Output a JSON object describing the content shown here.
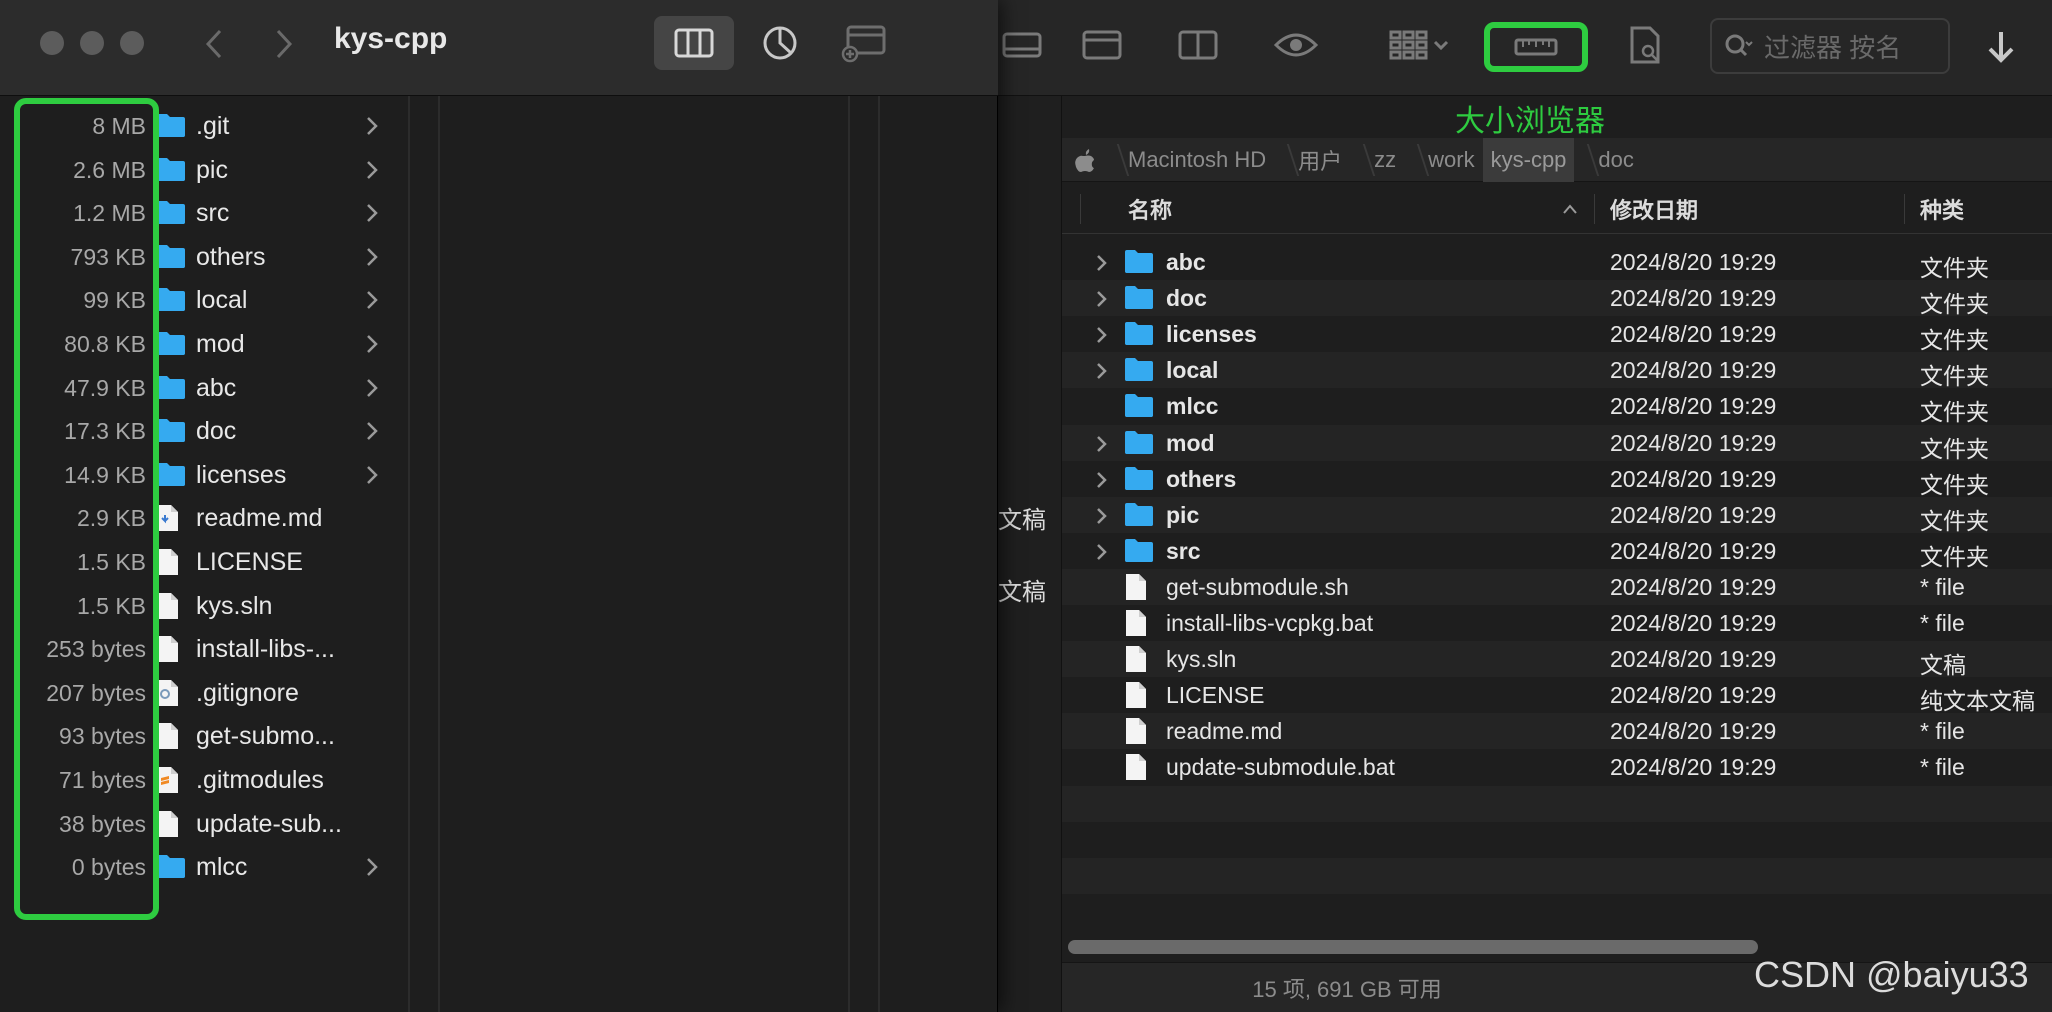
{
  "front_window": {
    "title": "kys-cpp",
    "rows": [
      {
        "size": "8 MB",
        "name": ".git",
        "icon": "folder",
        "has_children": true
      },
      {
        "size": "2.6 MB",
        "name": "pic",
        "icon": "folder",
        "has_children": true
      },
      {
        "size": "1.2 MB",
        "name": "src",
        "icon": "folder",
        "has_children": true
      },
      {
        "size": "793 KB",
        "name": "others",
        "icon": "folder",
        "has_children": true
      },
      {
        "size": "99 KB",
        "name": "local",
        "icon": "folder",
        "has_children": true
      },
      {
        "size": "80.8 KB",
        "name": "mod",
        "icon": "folder",
        "has_children": true
      },
      {
        "size": "47.9 KB",
        "name": "abc",
        "icon": "folder",
        "has_children": true
      },
      {
        "size": "17.3 KB",
        "name": "doc",
        "icon": "folder",
        "has_children": true
      },
      {
        "size": "14.9 KB",
        "name": "licenses",
        "icon": "folder",
        "has_children": true
      },
      {
        "size": "2.9 KB",
        "name": "readme.md",
        "icon": "markdown-file",
        "has_children": false
      },
      {
        "size": "1.5 KB",
        "name": "LICENSE",
        "icon": "file",
        "has_children": false
      },
      {
        "size": "1.5 KB",
        "name": "kys.sln",
        "icon": "file",
        "has_children": false
      },
      {
        "size": "253 bytes",
        "name": "install-libs-...",
        "icon": "file",
        "has_children": false
      },
      {
        "size": "207 bytes",
        "name": ".gitignore",
        "icon": "gear-file",
        "has_children": false
      },
      {
        "size": "93 bytes",
        "name": "get-submo...",
        "icon": "file",
        "has_children": false
      },
      {
        "size": "71 bytes",
        "name": ".gitmodules",
        "icon": "sublime-file",
        "has_children": false
      },
      {
        "size": "38 bytes",
        "name": "update-sub...",
        "icon": "file",
        "has_children": false
      },
      {
        "size": "0 bytes",
        "name": "mlcc",
        "icon": "folder",
        "has_children": true
      }
    ]
  },
  "back_window": {
    "size_browser_label": "大小浏览器",
    "filter_placeholder": "过滤器 按名",
    "path": [
      "Macintosh HD",
      "用户",
      "zz",
      "work",
      "kys-cpp",
      "doc"
    ],
    "sidebar_labels": [
      "文稿",
      "文稿"
    ],
    "columns": {
      "name": "名称",
      "date": "修改日期",
      "kind": "种类"
    },
    "rows": [
      {
        "name": "abc",
        "date": "2024/8/20 19:29",
        "kind": "文件夹",
        "folder": true,
        "disclosure": true
      },
      {
        "name": "doc",
        "date": "2024/8/20 19:29",
        "kind": "文件夹",
        "folder": true,
        "disclosure": true
      },
      {
        "name": "licenses",
        "date": "2024/8/20 19:29",
        "kind": "文件夹",
        "folder": true,
        "disclosure": true
      },
      {
        "name": "local",
        "date": "2024/8/20 19:29",
        "kind": "文件夹",
        "folder": true,
        "disclosure": true
      },
      {
        "name": "mlcc",
        "date": "2024/8/20 19:29",
        "kind": "文件夹",
        "folder": true,
        "disclosure": false
      },
      {
        "name": "mod",
        "date": "2024/8/20 19:29",
        "kind": "文件夹",
        "folder": true,
        "disclosure": true
      },
      {
        "name": "others",
        "date": "2024/8/20 19:29",
        "kind": "文件夹",
        "folder": true,
        "disclosure": true
      },
      {
        "name": "pic",
        "date": "2024/8/20 19:29",
        "kind": "文件夹",
        "folder": true,
        "disclosure": true
      },
      {
        "name": "src",
        "date": "2024/8/20 19:29",
        "kind": "文件夹",
        "folder": true,
        "disclosure": true
      },
      {
        "name": "get-submodule.sh",
        "date": "2024/8/20 19:29",
        "kind": "* file",
        "folder": false,
        "disclosure": false
      },
      {
        "name": "install-libs-vcpkg.bat",
        "date": "2024/8/20 19:29",
        "kind": "* file",
        "folder": false,
        "disclosure": false
      },
      {
        "name": "kys.sln",
        "date": "2024/8/20 19:29",
        "kind": "文稿",
        "folder": false,
        "disclosure": false
      },
      {
        "name": "LICENSE",
        "date": "2024/8/20 19:29",
        "kind": "纯文本文稿",
        "folder": false,
        "disclosure": false
      },
      {
        "name": "readme.md",
        "date": "2024/8/20 19:29",
        "kind": "* file",
        "folder": false,
        "disclosure": false
      },
      {
        "name": "update-submodule.bat",
        "date": "2024/8/20 19:29",
        "kind": "* file",
        "folder": false,
        "disclosure": false
      }
    ],
    "status": "15 项, 691 GB 可用"
  },
  "watermark": "CSDN @baiyu33",
  "colors": {
    "highlight": "#2ecc40",
    "folder": "#35aaf0",
    "bg": "#1e1e1e"
  }
}
